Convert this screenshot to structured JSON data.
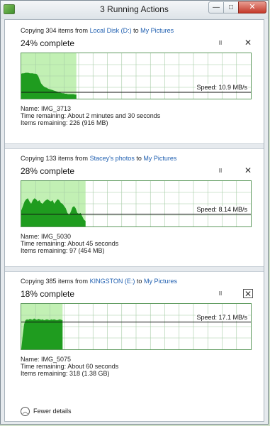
{
  "window": {
    "title": "3 Running Actions",
    "minimize_glyph": "—",
    "maximize_glyph": "□",
    "close_glyph": "✕"
  },
  "colors": {
    "graph_fill_done": "#c2f0b4",
    "graph_fill_area": "#1f9c1f",
    "graph_grid": "#a5cca5",
    "link": "#1f5fb0"
  },
  "operations": [
    {
      "copying_prefix": "Copying 304 items from",
      "source": "Local Disk (D:)",
      "to_word": "to",
      "destination": "My Pictures",
      "percent_label": "24% complete",
      "progress": 0.24,
      "speed_label": "Speed: 10.9 MB/s",
      "speed_level": 0.14,
      "pause_glyph": "II",
      "cancel_glyph": "✕",
      "cancel_boxed": false,
      "name": "Name:  IMG_3713",
      "time_remaining": "Time remaining:  About 2 minutes and 30 seconds",
      "items_remaining": "Items remaining:  226 (916 MB)",
      "history": [
        0.55,
        0.56,
        0.56,
        0.57,
        0.57,
        0.57,
        0.56,
        0.56,
        0.56,
        0.55,
        0.55,
        0.54,
        0.5,
        0.42,
        0.34,
        0.3,
        0.27,
        0.25,
        0.24,
        0.22,
        0.21,
        0.2,
        0.19,
        0.18,
        0.17,
        0.16,
        0.15,
        0.14,
        0.13,
        0.12,
        0.12,
        0.11,
        0.11,
        0.1,
        0.1,
        0.1,
        0.1,
        0.1,
        0.09,
        0.09
      ]
    },
    {
      "copying_prefix": "Copying 133 items from",
      "source": "Stacey's photos",
      "to_word": "to",
      "destination": "My Pictures",
      "percent_label": "28% complete",
      "progress": 0.28,
      "speed_label": "Speed: 8.14 MB/s",
      "speed_level": 0.27,
      "pause_glyph": "II",
      "cancel_glyph": "✕",
      "cancel_boxed": false,
      "name": "Name:  IMG_5030",
      "time_remaining": "Time remaining:  About 45 seconds",
      "items_remaining": "Items remaining:  97 (454 MB)",
      "history": [
        0.35,
        0.45,
        0.55,
        0.6,
        0.62,
        0.55,
        0.5,
        0.58,
        0.62,
        0.6,
        0.55,
        0.58,
        0.52,
        0.5,
        0.55,
        0.58,
        0.6,
        0.57,
        0.55,
        0.58,
        0.5,
        0.55,
        0.6,
        0.58,
        0.52,
        0.5,
        0.45,
        0.4,
        0.3,
        0.25,
        0.32,
        0.42,
        0.45,
        0.4,
        0.3,
        0.28,
        0.3,
        0.22,
        0.15,
        0.12
      ]
    },
    {
      "copying_prefix": "Copying 385 items from",
      "source": "KINGSTON (E:)",
      "to_word": "to",
      "destination": "My Pictures",
      "percent_label": "18% complete",
      "progress": 0.18,
      "speed_label": "Speed: 17.1 MB/s",
      "speed_level": 0.6,
      "pause_glyph": "II",
      "cancel_glyph": "✕",
      "cancel_boxed": true,
      "name": "Name:  IMG_5075",
      "time_remaining": "Time remaining:  About 60 seconds",
      "items_remaining": "Items remaining:  318 (1.38 GB)",
      "history": [
        0.0,
        0.3,
        0.55,
        0.64,
        0.66,
        0.65,
        0.67,
        0.66,
        0.65,
        0.68,
        0.66,
        0.65,
        0.67,
        0.66,
        0.65,
        0.66,
        0.64,
        0.65,
        0.66,
        0.65,
        0.64,
        0.66,
        0.65,
        0.66,
        0.65,
        0.64,
        0.65,
        0.66,
        0.65,
        0.64
      ]
    }
  ],
  "footer": {
    "fewer_details_label": "Fewer details",
    "chevron_glyph": "︿"
  }
}
